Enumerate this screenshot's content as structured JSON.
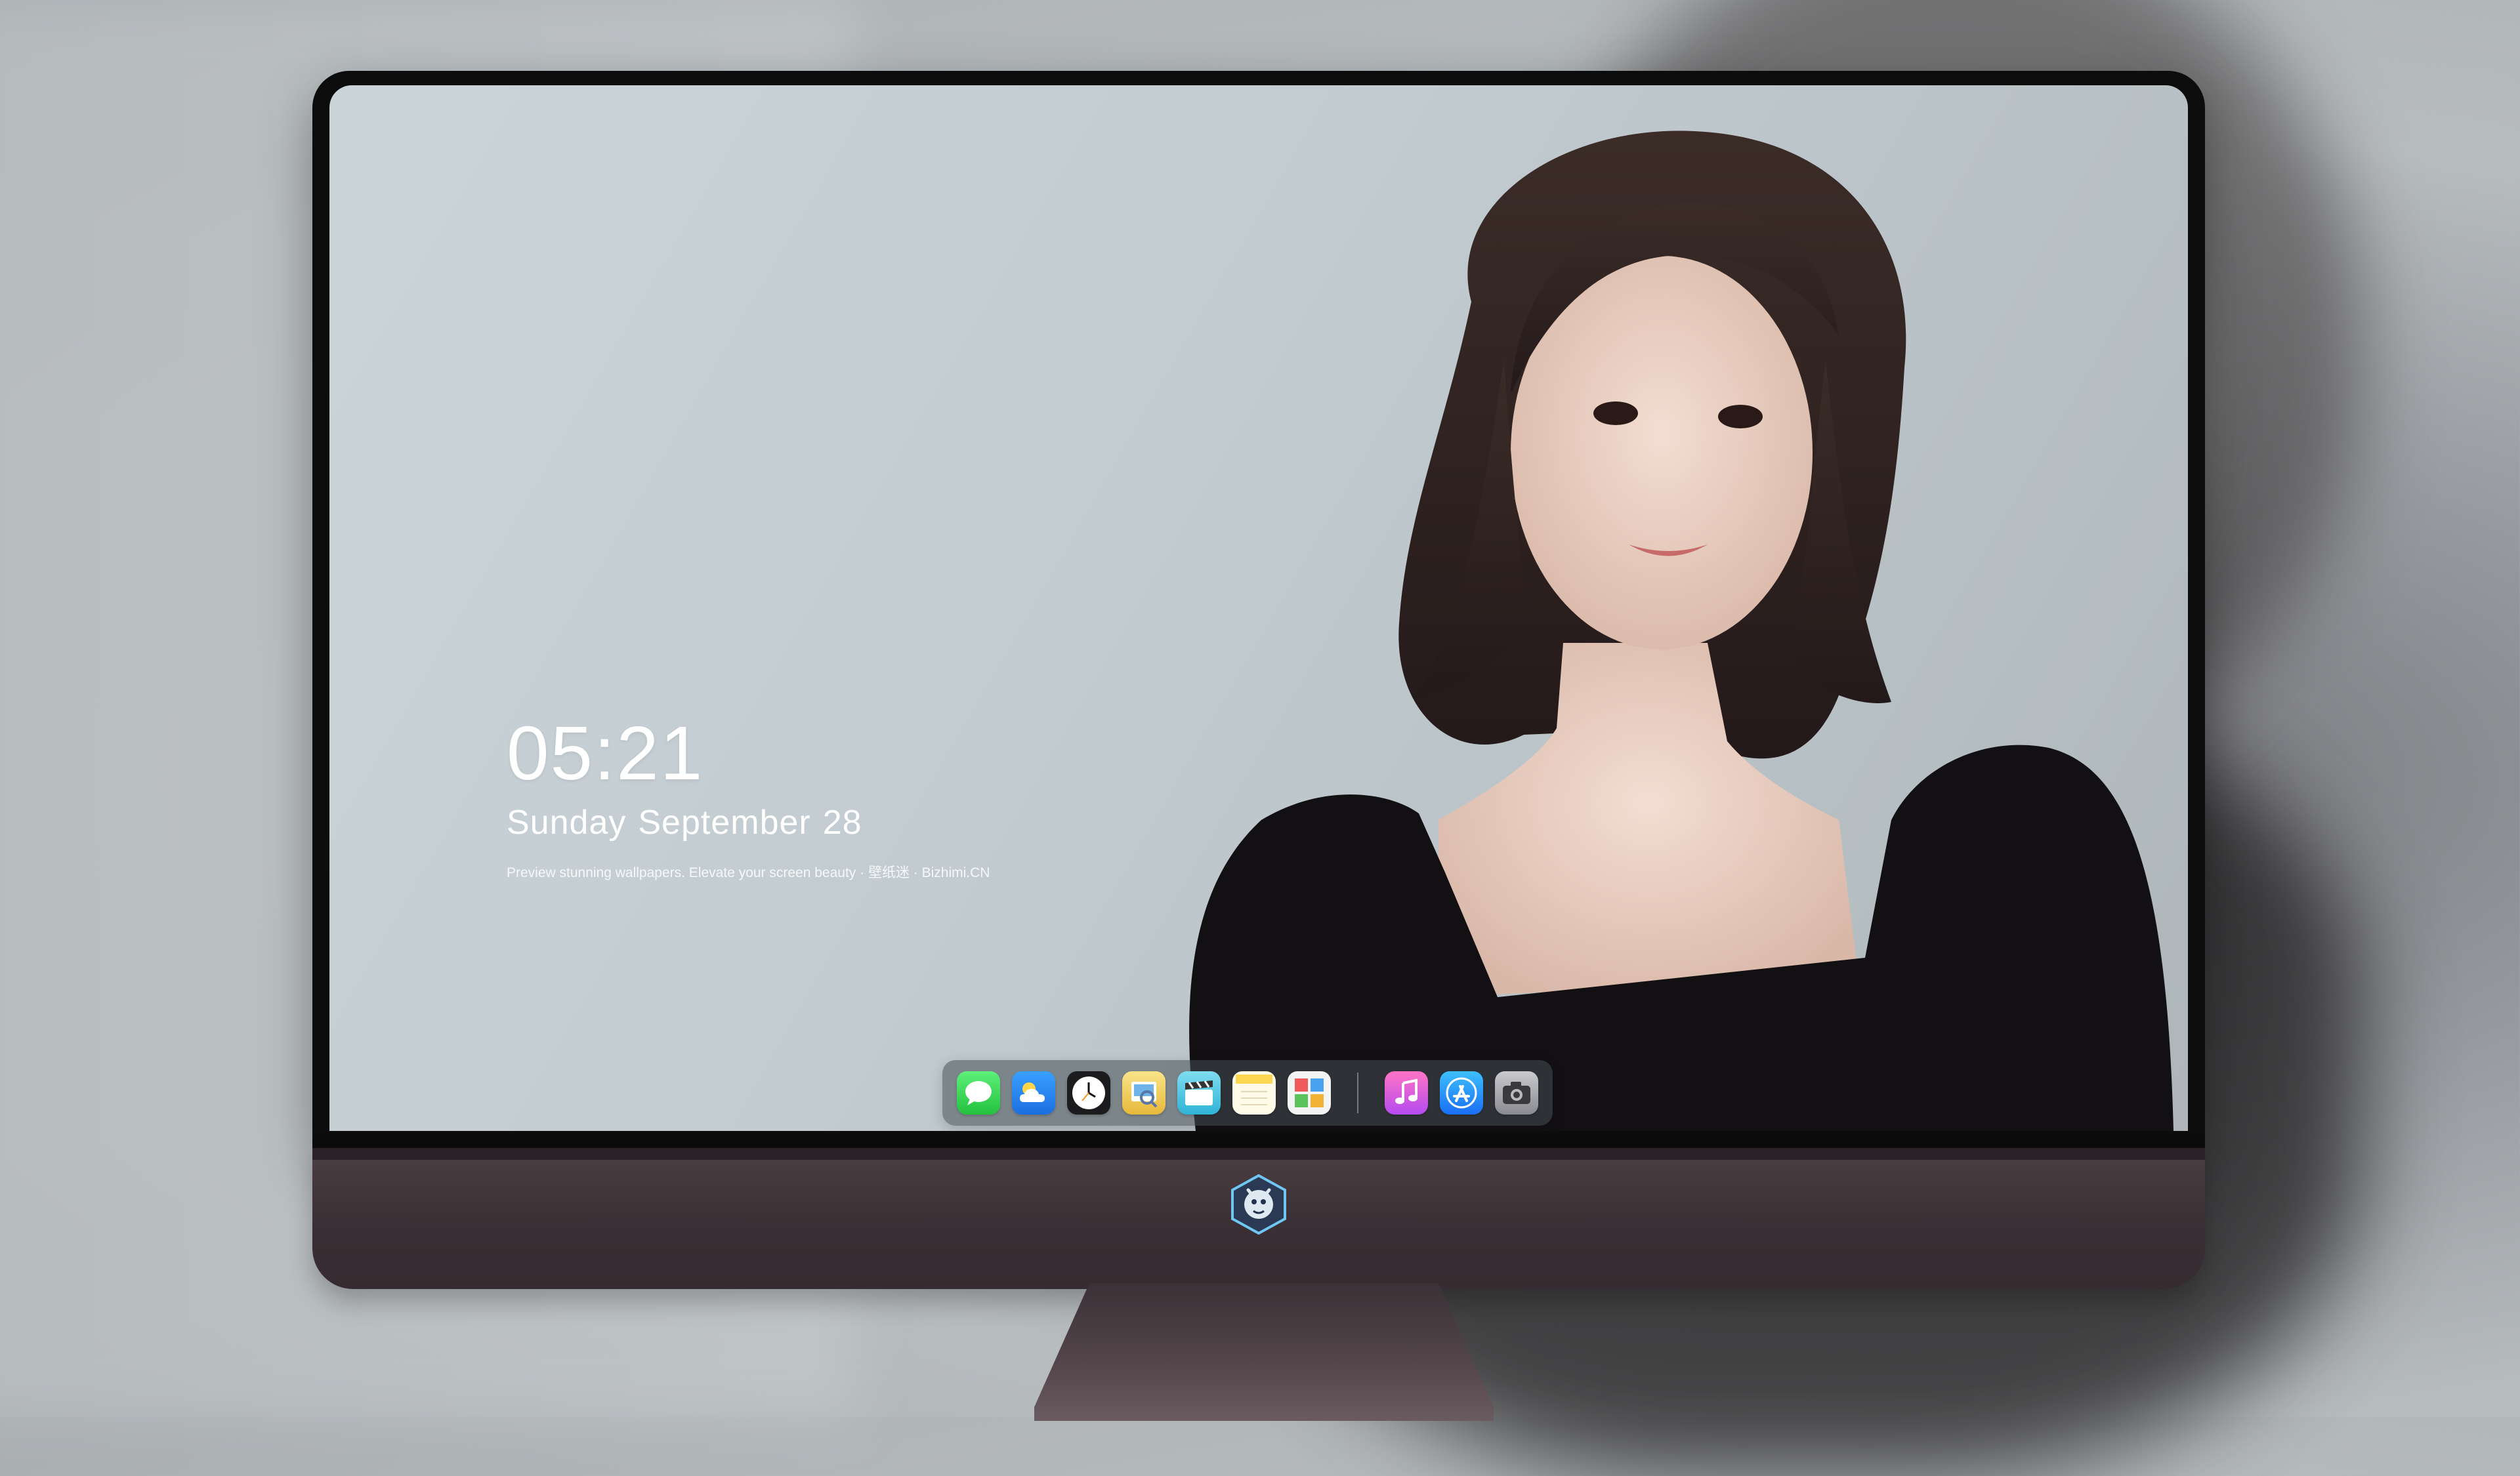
{
  "clock": {
    "time": "05:21",
    "weekday": "Sunday",
    "month": "September",
    "day": "28",
    "caption": "Preview stunning wallpapers. Elevate your screen beauty · 壁纸迷 · Bizhimi.CN"
  },
  "dock": {
    "apps": [
      {
        "name": "messages",
        "icon": "message-bubble-icon",
        "color": "#2fd158"
      },
      {
        "name": "weather",
        "icon": "cloud-icon",
        "color": "#1f86f2"
      },
      {
        "name": "clock",
        "icon": "clock-icon",
        "color": "#1c1c1e"
      },
      {
        "name": "preview",
        "icon": "preview-icon",
        "color": "#f1c232"
      },
      {
        "name": "clips",
        "icon": "clapperboard-icon",
        "color": "#4fc8e0"
      },
      {
        "name": "notes",
        "icon": "notes-icon",
        "color": "#fde26a"
      },
      {
        "name": "photo-booth",
        "icon": "grid-photos-icon",
        "color": "#5ba3e5"
      },
      {
        "name": "music",
        "icon": "music-note-icon",
        "color": "#fb3a62"
      },
      {
        "name": "app-store",
        "icon": "app-store-icon",
        "color": "#1c8ef9"
      },
      {
        "name": "camera",
        "icon": "camera-icon",
        "color": "#8e8e93"
      }
    ]
  },
  "monitor": {
    "chin_logo": "dragon-badge-icon",
    "chin_color": "#3f3338"
  }
}
